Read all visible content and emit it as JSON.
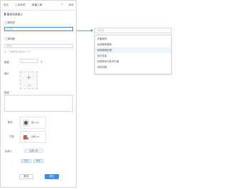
{
  "tabs": {
    "items": [
      "首页",
      "工单管理",
      "新建工单"
    ],
    "action_label": "刷新"
  },
  "form": {
    "section_title": "基本信息录入",
    "fields": [
      {
        "label": "工单类型",
        "required": true,
        "placeholder": "请选择"
      },
      {
        "label": "工单标题",
        "required": true,
        "placeholder": "请输入"
      },
      {
        "label": "数量",
        "required": false,
        "placeholder": "1"
      }
    ],
    "hint": "注：工单标题不超过50个字",
    "qty_unit": "个",
    "upload_label": "图片",
    "upload_caption": "上传",
    "desc_label": "描述",
    "attach1_label": "附件",
    "attach1_name": "图片.jpg",
    "attach2_label": "文档",
    "attach2_name": "说明.doc",
    "toggle_label": "负责人",
    "toggle_value": "选择人员",
    "mini_buttons": [
      "添加",
      "删除"
    ],
    "cancel_label": "取消",
    "submit_label": "提交"
  },
  "dropdown": {
    "placeholder": "请选择",
    "options": [
      "设备维修",
      "系统故障报修",
      "网络故障处理",
      "软件安装",
      "权限申请与账号开通",
      "其他问题"
    ],
    "highlighted_index": 2
  },
  "colors": {
    "accent": "#3b8ce8",
    "connector": "#6a9fd8",
    "required": "#e64545"
  }
}
